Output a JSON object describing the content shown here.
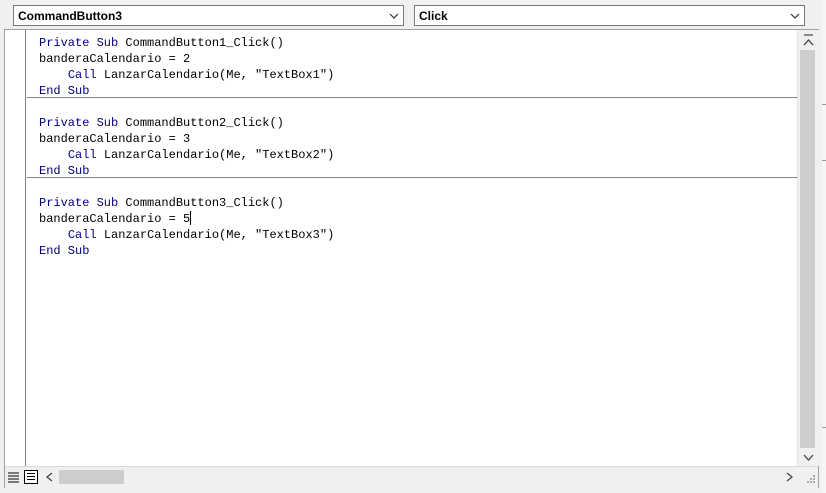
{
  "object_dropdown": {
    "selected": "CommandButton3",
    "icon": "chevron-down-icon"
  },
  "procedure_dropdown": {
    "selected": "Click",
    "icon": "chevron-down-icon"
  },
  "procedures": [
    {
      "lines": [
        {
          "kw1": "Private Sub",
          "rest": " CommandButton1_Click()"
        },
        {
          "text": "banderaCalendario = 2"
        },
        {
          "indent": "    ",
          "kw": "Call",
          "rest": " LanzarCalendario(Me, \"TextBox1\")"
        },
        {
          "kw": "End Sub"
        }
      ]
    },
    {
      "lines": [
        {
          "kw1": "Private Sub",
          "rest": " CommandButton2_Click()"
        },
        {
          "text": "banderaCalendario = 3"
        },
        {
          "indent": "    ",
          "kw": "Call",
          "rest": " LanzarCalendario(Me, \"TextBox2\")"
        },
        {
          "kw": "End Sub"
        }
      ]
    },
    {
      "lines": [
        {
          "kw1": "Private Sub",
          "rest": " CommandButton3_Click()"
        },
        {
          "text": "banderaCalendario = 5"
        },
        {
          "indent": "    ",
          "kw": "Call",
          "rest": " LanzarCalendario(Me, \"TextBox3\")"
        },
        {
          "kw": "End Sub"
        }
      ]
    }
  ],
  "scrollbars": {
    "vertical_up_icon": "chevron-up-icon",
    "vertical_down_icon": "chevron-down-icon",
    "horizontal_left_icon": "chevron-left-icon",
    "horizontal_right_icon": "chevron-right-icon"
  },
  "view_buttons": {
    "procedure_view_icon": "procedure-view-icon",
    "module_view_icon": "full-module-view-icon"
  },
  "colors": {
    "keyword": "#00007f",
    "code_text": "#000000",
    "background": "#ffffff",
    "chrome": "#f0f0f0"
  }
}
